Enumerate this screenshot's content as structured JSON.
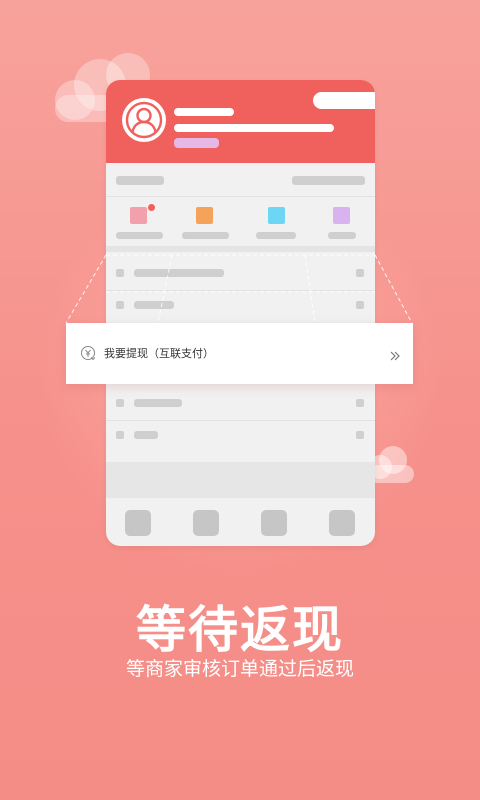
{
  "card": {
    "label": "我要提现（互联支付）"
  },
  "headline": {
    "title": "等待返现",
    "subtitle": "等商家审核订单通过后返现"
  },
  "colors": {
    "background": "#f6908a",
    "header": "#f0605d",
    "tile_pink": "#f3a0ad",
    "tile_orange": "#f5a25a",
    "tile_cyan": "#6cd6f4",
    "tile_purple": "#d9b3ef"
  },
  "icons": {
    "avatar": "user-avatar-icon",
    "withdraw": "yen-coin-icon",
    "chevron": "double-chevron-right-icon"
  }
}
